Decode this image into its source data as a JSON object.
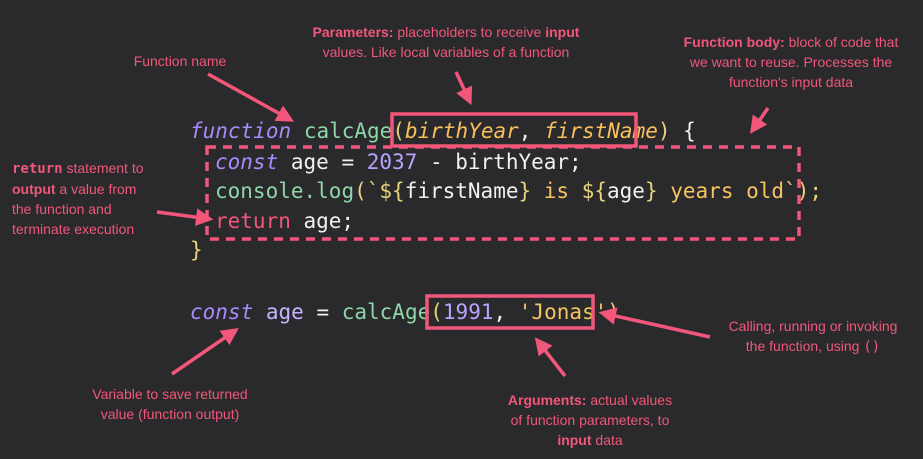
{
  "code": {
    "line1": {
      "kw": "function",
      "name": "calcAge",
      "paren_open": "(",
      "p1": "birthYear",
      "comma": ", ",
      "p2": "firstName",
      "paren_close": ")",
      "brace": " {"
    },
    "line2": {
      "kw": "const",
      "var": " age ",
      "eq": "= ",
      "num": "2037",
      "rest": " - birthYear;"
    },
    "line3": {
      "obj": "console.",
      "fn": "log",
      "open": "(`",
      "t1": "${",
      "v1": "firstName",
      "t2": "}",
      "s1": " is ",
      "t3": "${",
      "v2": "age",
      "t4": "}",
      "s2": " years old",
      "close": "`);"
    },
    "line4": {
      "ret": "return",
      "rest": " age;"
    },
    "line5": {
      "brace": "}"
    },
    "line6": {
      "kw": "const",
      "var": " age ",
      "eq": "= ",
      "fn": "calcAge",
      "open": "(",
      "num": "1991",
      "comma": ", ",
      "str": "'Jonas'",
      "close": ")"
    }
  },
  "annotations": {
    "function_name": "Function name",
    "parameters_bold": "Parameters:",
    "parameters_text1": " placeholders to receive ",
    "parameters_input": "input",
    "parameters_text2": "values. Like local variables of a function",
    "body_bold": "Function body:",
    "body_text1": " block of code that",
    "body_text2": "we want to reuse. Processes the",
    "body_text3": "function's input data",
    "return_code": "return",
    "return_text1": " statement to",
    "return_output": "output",
    "return_text2": " a value from",
    "return_text3": "the function and",
    "return_text4": "terminate execution",
    "calling_text1": "Calling, running or invoking",
    "calling_text2": "the function, using ",
    "calling_parens": "()",
    "variable_text1": "Variable to save returned",
    "variable_text2": "value (function output)",
    "arguments_bold": "Arguments:",
    "arguments_text1": " actual values",
    "arguments_text2": "of function parameters, to",
    "arguments_input": "input",
    "arguments_text3": " data"
  },
  "colors": {
    "accent": "#f2567a",
    "background": "#2a2a2c"
  }
}
